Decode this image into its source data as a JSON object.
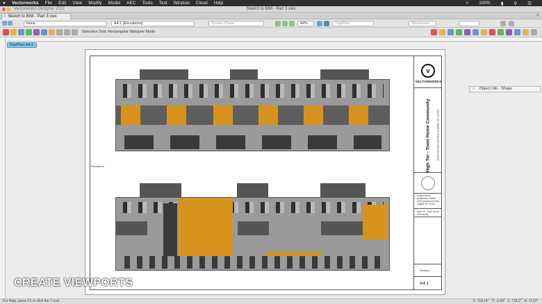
{
  "menubar": {
    "apple": "",
    "items": [
      "Vectorworks",
      "File",
      "Edit",
      "View",
      "Modify",
      "Model",
      "AEC",
      "Tools",
      "Text",
      "Window",
      "Cloud",
      "Help"
    ],
    "battery": "100%"
  },
  "window": {
    "app_name": "Vectorworks Designer 2021",
    "doc_title": "Sketch to BIM - Part 3.vwx"
  },
  "tabs": [
    {
      "label": "Sketch to BIM - Part 3.vwx"
    }
  ],
  "toolbar": {
    "class_dropdown": "None",
    "layer_dropdown": "A4.1 [Elevations]",
    "plane_dropdown": "Screen Plane",
    "zoom": "44%",
    "view_dropdown": "Top/Plan",
    "render_dropdown": "Wireframe",
    "tool_hint": "Selection Tool: Rectangular Marquee Mode"
  },
  "view_tag": "Top/Plan  A4.1",
  "sheet": {
    "brand": "VECTORWORKS",
    "project_title": "High Tor - Town Home Community",
    "project_address": "1150 Arrowwood Drive Catskill, NY 12414",
    "tb_info": [
      "Project Name",
      "Architecture Studio",
      "1150 Arrowwood Drive",
      "Catskill, NY 12414"
    ],
    "tb_subtitle": "High Tor - Town Home Community",
    "drawing_name": "Elevations",
    "sheet_number": "A4.1",
    "elevation_label": "Elevations"
  },
  "object_info": {
    "title": "Object Info - Shape"
  },
  "caption": "CREATE VIEWPORTS",
  "status": {
    "help": "For Help, press F1 or click the ? icon",
    "x": "X: 718.14\"",
    "y": "Y: -1.69\"",
    "l": "L: 718.2\"",
    "a": "A: -0.13°"
  },
  "colors": {
    "accent": "#d8931f",
    "facade": "#9a9a9a",
    "window": "#2f2f2f",
    "view_tag": "#7fc3ea"
  }
}
